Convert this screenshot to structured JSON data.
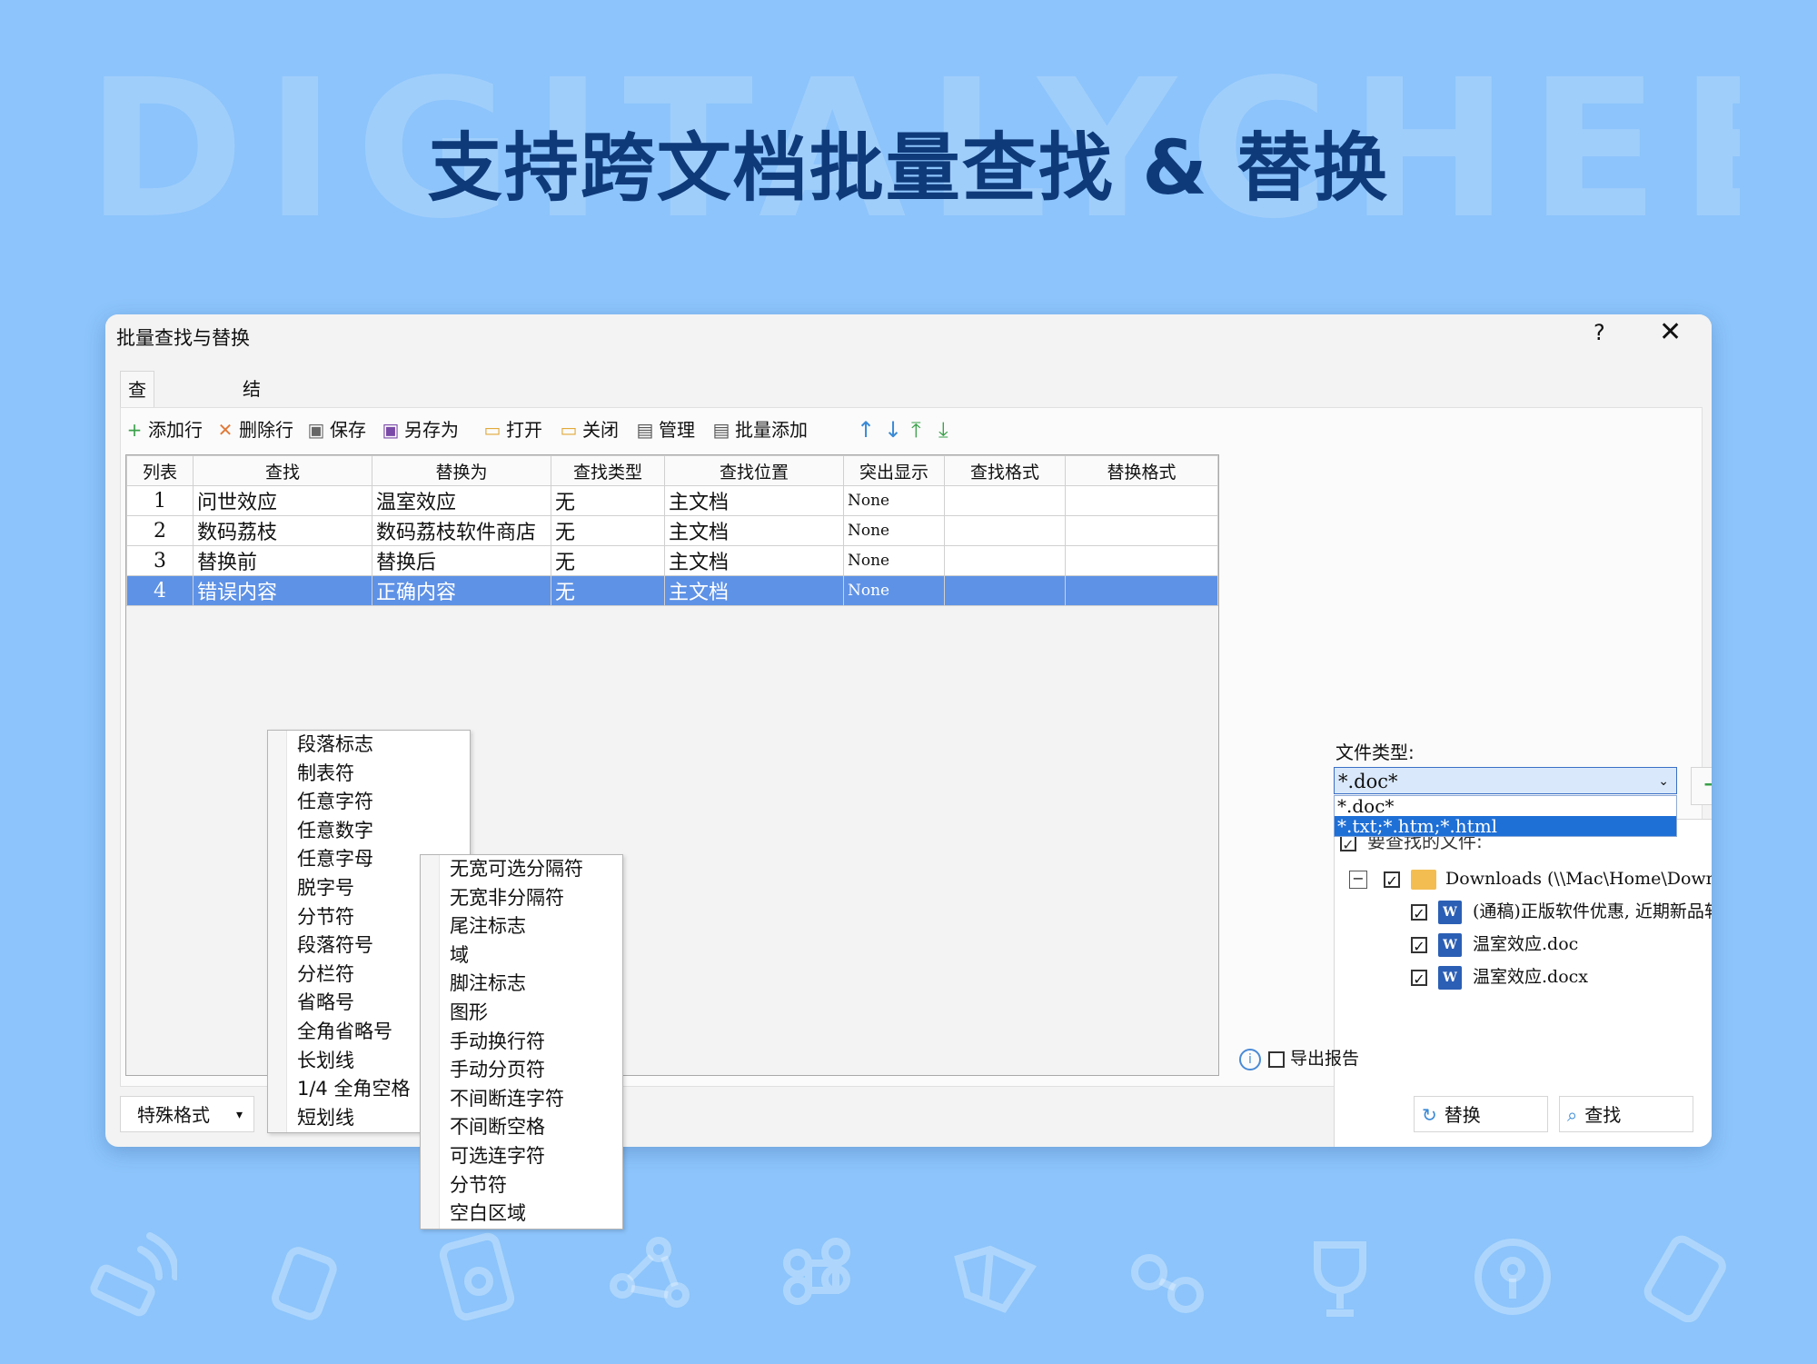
{
  "background": {
    "watermark": "DIGITALYCHEE",
    "headline": "支持跨文档批量查找 & 替换",
    "colors": {
      "background": "#8cc4fb",
      "headline": "#0f3a7a",
      "selection": "#5e92e6",
      "accent": "#1e6fd6"
    },
    "deco_icons": [
      "wifi-router-icon",
      "usb-drive-icon",
      "secure-file-icon",
      "network-nodes-icon",
      "command-key-icon",
      "book-icon",
      "glasses-icon",
      "trophy-icon",
      "key-icon",
      "sd-card-icon"
    ]
  },
  "dialog": {
    "title": "批量查找与替换",
    "help": "?",
    "close": "✕",
    "tabs": [
      "查找和替换",
      "结果"
    ],
    "toolbar": [
      {
        "label": "添加行",
        "icon": "plus-icon",
        "glyph": "+"
      },
      {
        "label": "删除行",
        "icon": "delete-x-icon",
        "glyph": "✕"
      },
      {
        "label": "保存",
        "icon": "save-icon",
        "glyph": "▣"
      },
      {
        "label": "另存为",
        "icon": "save-as-icon",
        "glyph": "▣"
      },
      {
        "label": "打开",
        "icon": "open-folder-icon",
        "glyph": "▭"
      },
      {
        "label": "关闭",
        "icon": "close-folder-icon",
        "glyph": "▭"
      },
      {
        "label": "管理",
        "icon": "manage-list-icon",
        "glyph": "▤"
      },
      {
        "label": "批量添加",
        "icon": "batch-add-icon",
        "glyph": "▤"
      }
    ],
    "arrows": [
      "↑",
      "↓",
      "⤒",
      "⤓"
    ],
    "table": {
      "headers": [
        "列表",
        "查找",
        "替换为",
        "查找类型",
        "查找位置",
        "突出显示",
        "查找格式",
        "替换格式"
      ],
      "rows": [
        [
          "1",
          "问世效应",
          "温室效应",
          "无",
          "主文档",
          "None",
          "",
          ""
        ],
        [
          "2",
          "数码荔枝",
          "数码荔枝软件商店",
          "无",
          "主文档",
          "None",
          "",
          ""
        ],
        [
          "3",
          "替换前",
          "替换后",
          "无",
          "主文档",
          "None",
          "",
          ""
        ],
        [
          "4",
          "错误内容",
          "正确内容",
          "无",
          "主文档",
          "None",
          "",
          ""
        ]
      ]
    },
    "file_type": {
      "label": "文件类型:",
      "value": "*.doc*",
      "options": [
        "*.doc*",
        "*.txt;*.htm;*.html"
      ]
    },
    "tree": {
      "header": "要查找的文件:",
      "folder": "Downloads (\\\\Mac\\Home\\Downloads)",
      "files": [
        "(通稿)正版软件优惠, 近期新品软件推",
        "温室效应.doc",
        "温室效应.docx"
      ]
    },
    "export_label": "导出报告",
    "special_format": "特殊格式",
    "replace_button": "替换",
    "find_button": "查找"
  },
  "menu1": [
    "段落标志",
    "制表符",
    "任意字符",
    "任意数字",
    "任意字母",
    "脱字号",
    "分节符",
    "段落符号",
    "分栏符",
    "省略号",
    "全角省略号",
    "长划线",
    "1/4 全角空格",
    "短划线"
  ],
  "menu2": [
    "无宽可选分隔符",
    "无宽非分隔符",
    "尾注标志",
    "域",
    "脚注标志",
    "图形",
    "手动换行符",
    "手动分页符",
    "不间断连字符",
    "不间断空格",
    "可选连字符",
    "分节符",
    "空白区域"
  ]
}
